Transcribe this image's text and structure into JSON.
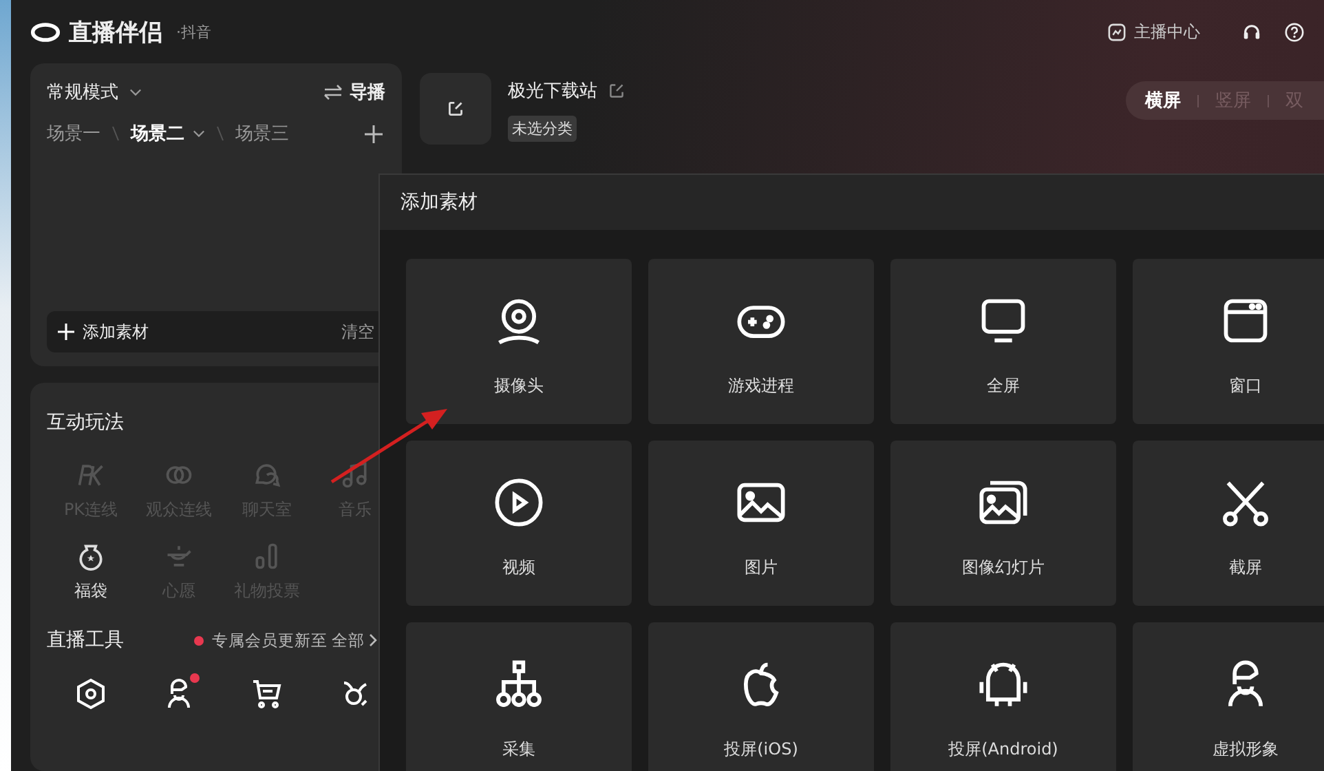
{
  "app": {
    "title": "直播伴侣",
    "platform": "·抖音"
  },
  "top_actions": {
    "center": "主播中心"
  },
  "scene_panel": {
    "mode": "常规模式",
    "director": "导播",
    "scenes": [
      {
        "label": "场景一",
        "selected": false
      },
      {
        "label": "场景二",
        "selected": true
      },
      {
        "label": "场景三",
        "selected": false
      }
    ],
    "add_source": "添加素材",
    "clear": "清空"
  },
  "source": {
    "name": "极光下载站",
    "category": "未选分类"
  },
  "orientation_tabs": [
    {
      "label": "横屏",
      "selected": true
    },
    {
      "label": "竖屏",
      "selected": false
    },
    {
      "label": "双",
      "selected": false
    }
  ],
  "interactive": {
    "title": "互动玩法",
    "items": [
      {
        "label": "PK连线",
        "kind": "pk",
        "disabled": true
      },
      {
        "label": "观众连线",
        "kind": "link",
        "disabled": true
      },
      {
        "label": "聊天室",
        "kind": "chat",
        "disabled": true
      },
      {
        "label": "音乐",
        "kind": "music",
        "disabled": true
      },
      {
        "label": "福袋",
        "kind": "bag",
        "disabled": false
      },
      {
        "label": "心愿",
        "kind": "lamp",
        "disabled": true
      },
      {
        "label": "礼物投票",
        "kind": "bars",
        "disabled": true
      }
    ]
  },
  "tools": {
    "title": "直播工具",
    "notice": "专属会员更新至",
    "more": "全部",
    "items": [
      {
        "kind": "hexagon",
        "badge": false
      },
      {
        "kind": "avatar",
        "badge": true
      },
      {
        "kind": "cart",
        "badge": false
      },
      {
        "kind": "taurus",
        "badge": false
      }
    ]
  },
  "dialog": {
    "title": "添加素材",
    "items": [
      {
        "label": "摄像头",
        "kind": "camera"
      },
      {
        "label": "游戏进程",
        "kind": "gamepad"
      },
      {
        "label": "全屏",
        "kind": "monitor"
      },
      {
        "label": "窗口",
        "kind": "window"
      },
      {
        "label": "视频",
        "kind": "play"
      },
      {
        "label": "图片",
        "kind": "image"
      },
      {
        "label": "图像幻灯片",
        "kind": "slides"
      },
      {
        "label": "截屏",
        "kind": "scissors"
      },
      {
        "label": "采集",
        "kind": "tree"
      },
      {
        "label": "投屏(iOS)",
        "kind": "apple"
      },
      {
        "label": "投屏(Android)",
        "kind": "android"
      },
      {
        "label": "虚拟形象",
        "kind": "avatar"
      }
    ]
  }
}
